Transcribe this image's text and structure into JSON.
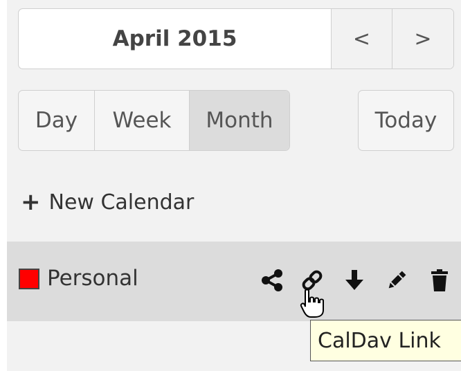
{
  "header": {
    "title": "April 2015",
    "prev_label": "<",
    "next_label": ">"
  },
  "views": {
    "day": "Day",
    "week": "Week",
    "month": "Month",
    "active": "Month"
  },
  "today_label": "Today",
  "new_calendar": {
    "icon": "plus-icon",
    "label": "New Calendar"
  },
  "calendar": {
    "name": "Personal",
    "color": "#ff0000",
    "actions": [
      "share-icon",
      "link-icon",
      "download-icon",
      "edit-icon",
      "delete-icon"
    ]
  },
  "tooltip": {
    "text": "CalDav Link"
  }
}
